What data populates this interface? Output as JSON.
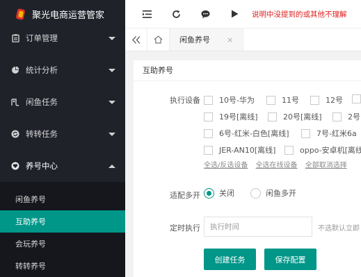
{
  "app": {
    "title": "聚光电商运营管家"
  },
  "sidebar": {
    "items": [
      {
        "label": "订单管理",
        "icon": "clipboard-icon"
      },
      {
        "label": "统计分析",
        "icon": "pie-chart-icon"
      },
      {
        "label": "闲鱼任务",
        "icon": "fish-icon"
      },
      {
        "label": "转转任务",
        "icon": "refresh-badge-icon"
      },
      {
        "label": "养号中心",
        "icon": "heart-icon"
      }
    ],
    "submenu": [
      {
        "label": "闲鱼养号"
      },
      {
        "label": "互助养号"
      },
      {
        "label": "会玩养号"
      },
      {
        "label": "转转养号"
      }
    ]
  },
  "header": {
    "notice": "说明中没提到的或其他不理解"
  },
  "tabs": {
    "items": [
      {
        "label": "闲鱼养号"
      }
    ],
    "close_glyph": "×"
  },
  "card": {
    "title": "互助养号",
    "device_label": "执行设备",
    "devices": [
      "10号-华为",
      "11号",
      "12号",
      "19号[离线]",
      "20号[离线]",
      "2号",
      "6号-红米-白色[离线]",
      "7号-红米6a",
      "JER-AN10[离线]",
      "oppo-安卓机[离线"
    ],
    "links": [
      "全选/反选设备",
      "全选在线设备",
      "全部取消选择"
    ],
    "multi_label": "适配多开",
    "multi_options": [
      "关闭",
      "闲鱼多开"
    ],
    "multi_selected": "关闭",
    "schedule_label": "定时执行",
    "schedule_placeholder": "执行时间",
    "schedule_hint": "不选默认立即",
    "create_button": "创建任务",
    "save_button": "保存配置"
  },
  "colors": {
    "accent": "#009688",
    "sidebar_bg": "#20222a",
    "notice": "#e02020"
  }
}
